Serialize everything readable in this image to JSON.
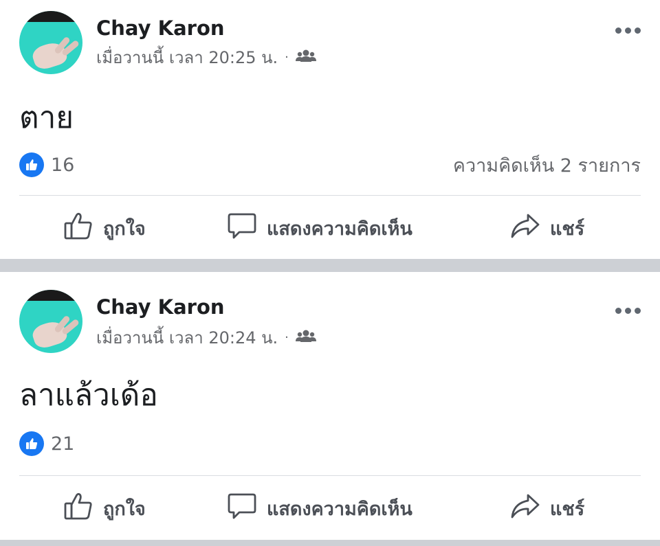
{
  "posts": [
    {
      "author": "Chay Karon",
      "time": "เมื่อวานนี้ เวลา 20:25 น.",
      "separator": "·",
      "audience_icon": "friends-icon",
      "text": "ตาย",
      "like_count": "16",
      "comment_count": "ความคิดเห็น 2 รายการ"
    },
    {
      "author": "Chay Karon",
      "time": "เมื่อวานนี้ เวลา 20:24 น.",
      "separator": "·",
      "audience_icon": "friends-icon",
      "text": "ลาแล้วเด้อ",
      "like_count": "21",
      "comment_count": ""
    }
  ],
  "actions": {
    "like_label": "ถูกใจ",
    "comment_label": "แสดงความคิดเห็น",
    "share_label": "แชร์"
  },
  "colors": {
    "like_blue": "#1877f2",
    "separator_gray": "#cdd0d5",
    "secondary_text": "#65676b"
  }
}
